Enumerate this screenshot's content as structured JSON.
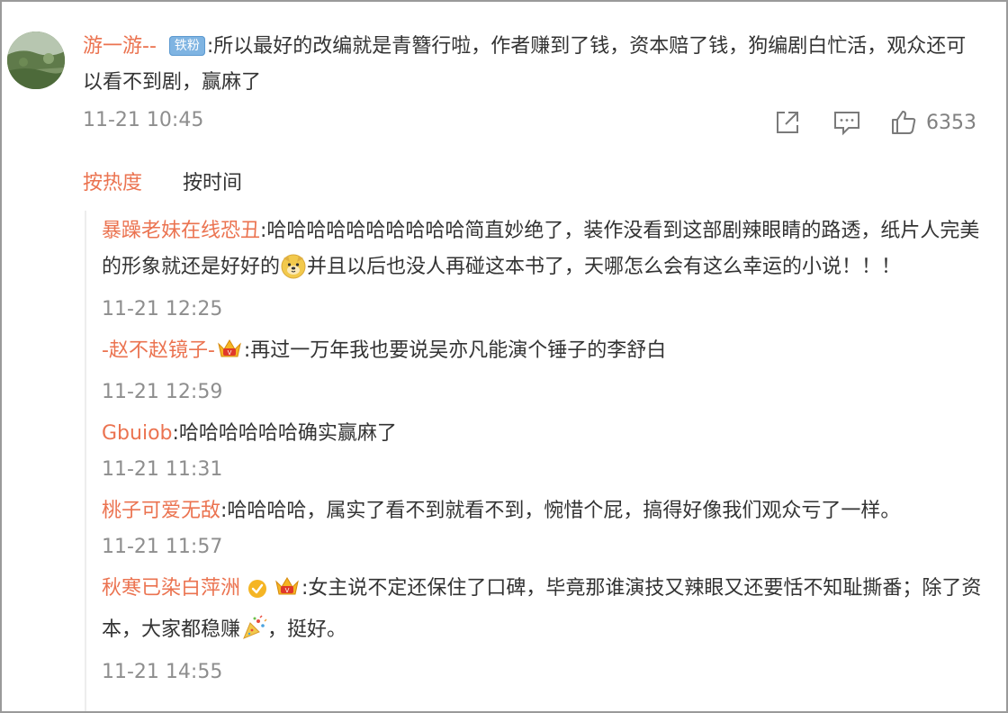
{
  "main_comment": {
    "username": "游一游--",
    "badge": "铁粉",
    "text": ":所以最好的改编就是青簪行啦，作者赚到了钱，资本赔了钱，狗编剧白忙活，观众还可以看不到剧，赢麻了",
    "time": "11-21 10:45",
    "like_count": "6353",
    "icons": [
      "share-icon",
      "comment-icon",
      "like-icon"
    ]
  },
  "sort_tabs": {
    "hot": "按热度",
    "time": "按时间"
  },
  "replies": [
    {
      "username": "暴躁老妹在线恐丑",
      "text_before": ":哈哈哈哈哈哈哈哈哈哈简直妙绝了，装作没看到这部剧辣眼睛的路透，纸片人完美的形象就还是好好的",
      "emoji": "doge-emoji",
      "text_after": "并且以后也没人再碰这本书了，天哪怎么会有这么幸运的小说！！！",
      "time": "11-21 12:25"
    },
    {
      "username": "-赵不赵镜子-",
      "badge_icon": "crown-badge-icon",
      "text": ":再过一万年我也要说吴亦凡能演个锤子的李舒白",
      "time": "11-21 12:59"
    },
    {
      "username": "Gbuiob",
      "text": ":哈哈哈哈哈哈确实赢麻了",
      "time": "11-21 11:31"
    },
    {
      "username": "桃子可爱无敌",
      "text": ":哈哈哈哈，属实了看不到就看不到，惋惜个屁，搞得好像我们观众亏了一样。",
      "time": "11-21 11:57"
    },
    {
      "username": "秋寒已染白萍洲",
      "verified_icon": "verified-badge-icon",
      "badge_icon": "crown-badge-icon",
      "text_before": ":女主说不定还保住了口碑，毕竟那谁演技又辣眼又还要恬不知耻撕番；除了资本，大家都稳赚",
      "emoji": "party-emoji",
      "text_after": "，挺好。",
      "time": "11-21 14:55"
    }
  ],
  "colors": {
    "username": "#eb7350",
    "body_text": "#333333",
    "timestamp": "#8e8e8e",
    "fan_badge": "#7fb4e2"
  }
}
